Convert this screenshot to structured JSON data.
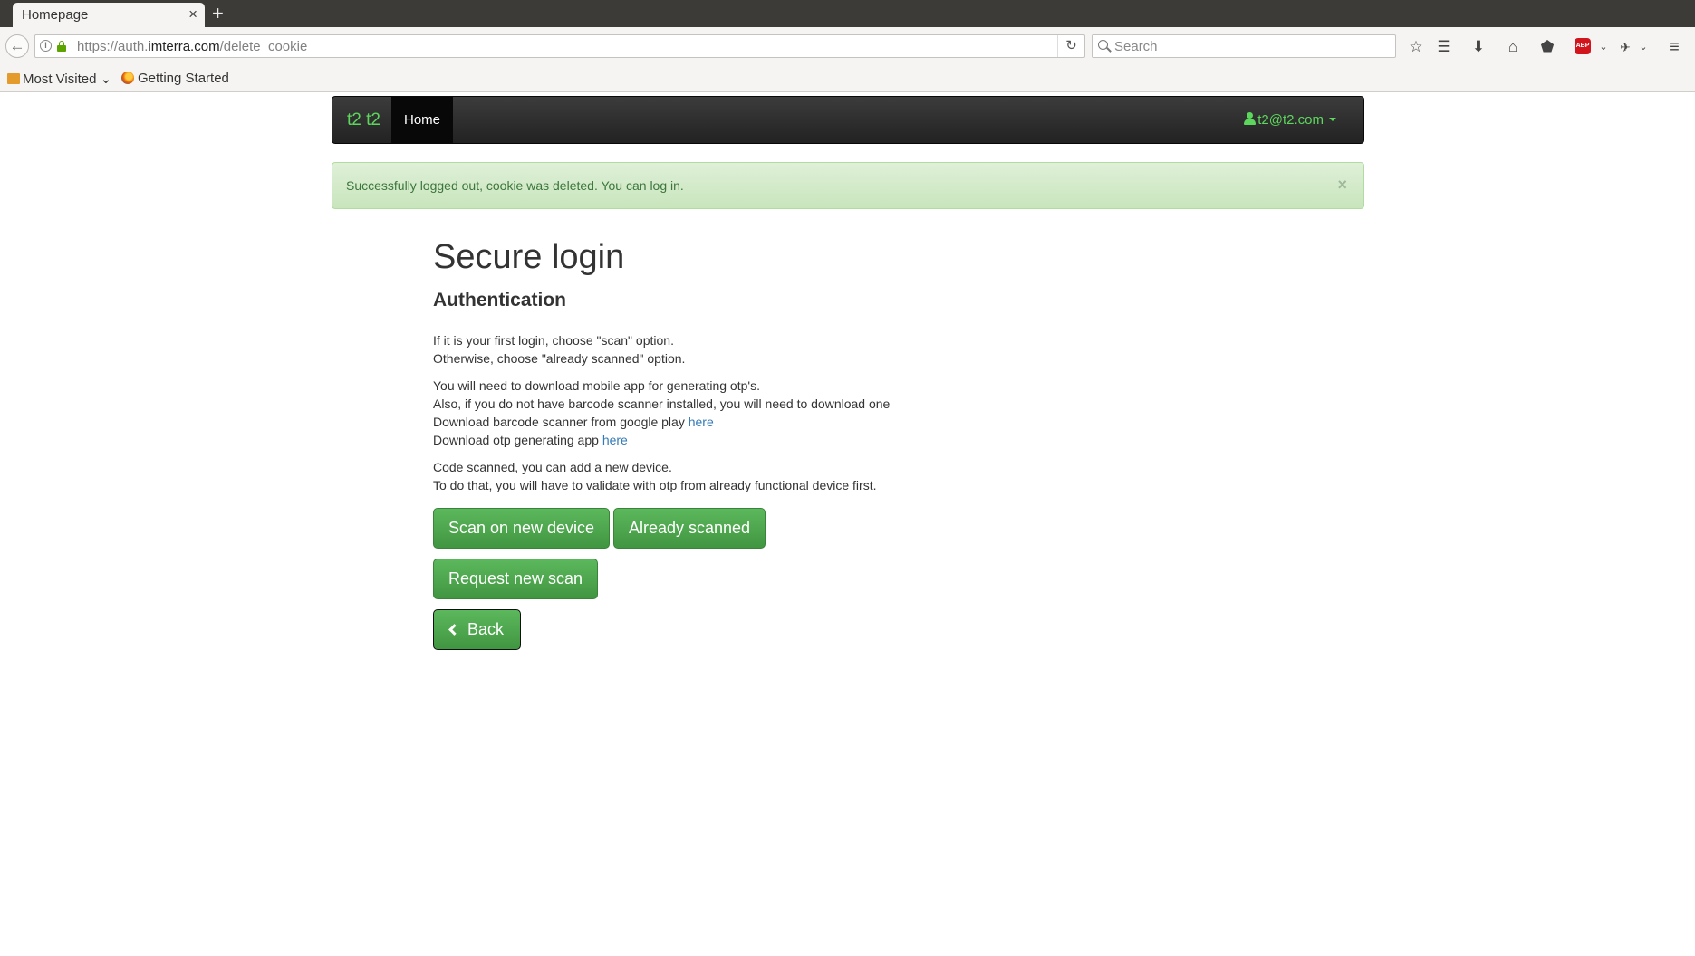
{
  "browser": {
    "tab_title": "Homepage",
    "tab_close": "×",
    "new_tab": "+",
    "url_prefix": "https://auth.",
    "url_domain": "imterra.com",
    "url_path": "/delete_cookie",
    "search_placeholder": "Search",
    "bookmarks": [
      {
        "label": "Most Visited"
      },
      {
        "label": "Getting Started"
      }
    ]
  },
  "site_nav": {
    "brand": "t2 t2",
    "home": "Home",
    "user_email": "t2@t2.com"
  },
  "alert": {
    "message": "Successfully logged out, cookie was deleted. You can log in.",
    "close": "×"
  },
  "main": {
    "title": "Secure login",
    "subtitle": "Authentication",
    "intro_line1": "If it is your first login, choose \"scan\" option.",
    "intro_line2": "Otherwise, choose \"already scanned\" option.",
    "download_line1": "You will need to download mobile app for generating otp's.",
    "download_line2": "Also, if you do not have barcode scanner installed, you will need to download one",
    "download_line3": "Download barcode scanner from google play ",
    "download_line3_link": "here",
    "download_line4": "Download otp generating app ",
    "download_line4_link": "here",
    "scanned_line1": "Code scanned, you can add a new device.",
    "scanned_line2": "To do that, you will have to validate with otp from already functional device first."
  },
  "buttons": {
    "scan_new": "Scan on new device",
    "already_scanned": "Already scanned",
    "request_scan": "Request new scan",
    "back": "Back"
  },
  "colors": {
    "accent_green": "#5cb85c",
    "brand_green": "#5cd65c",
    "link_blue": "#337ab7",
    "alert_bg": "#dff0d8"
  }
}
